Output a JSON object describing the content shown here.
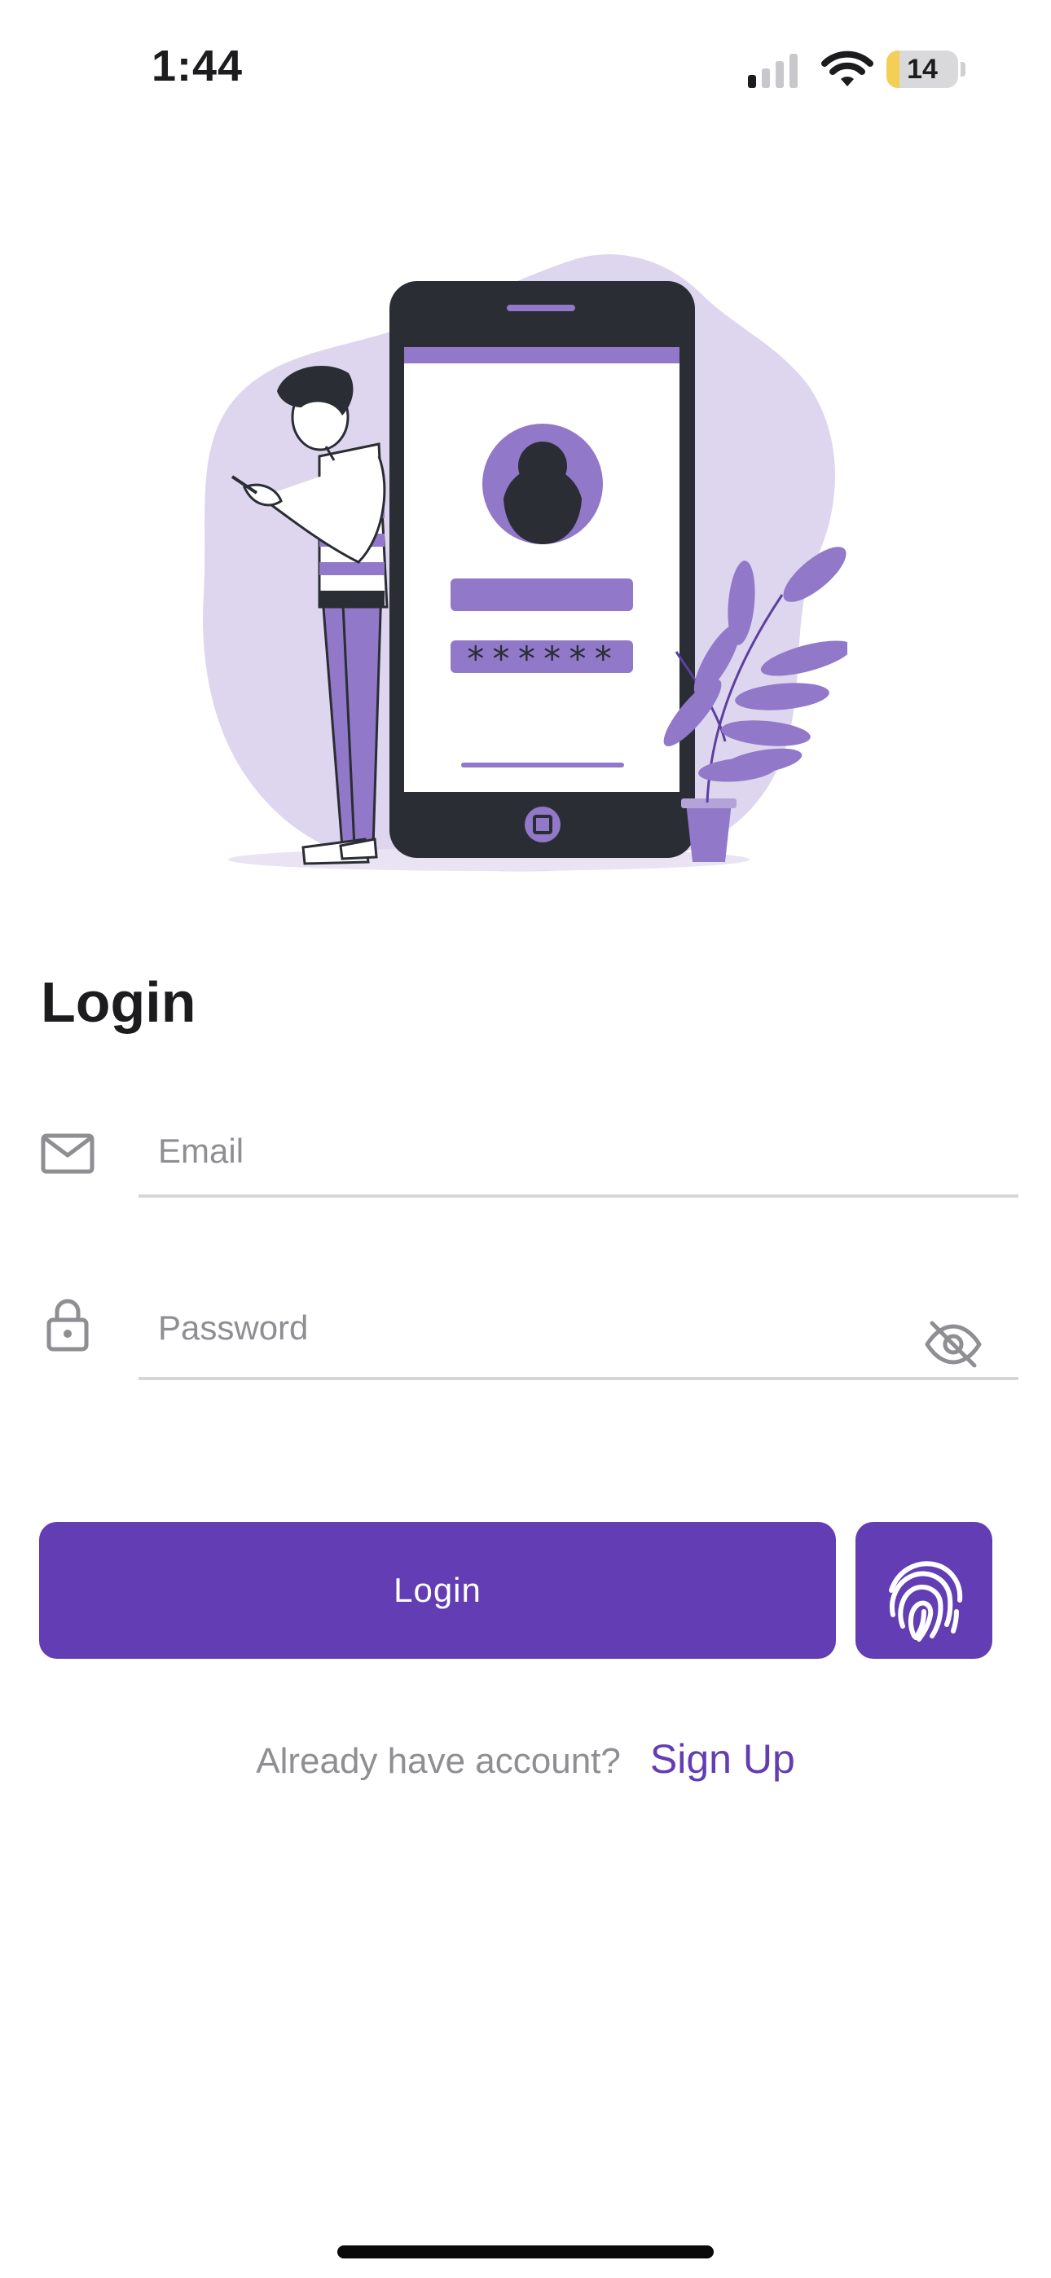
{
  "status_bar": {
    "time": "1:44",
    "battery_level": "14",
    "battery_fraction": 0.14,
    "icons": [
      "cellular-signal-icon",
      "wifi-icon",
      "battery-icon"
    ]
  },
  "illustration": {
    "phone_password_mask": "******"
  },
  "login": {
    "title": "Login",
    "email_placeholder": "Email",
    "password_placeholder": "Password",
    "button_label": "Login"
  },
  "signup": {
    "prompt": "Already have account?",
    "link_label": "Sign Up"
  },
  "colors": {
    "accent": "#623db3",
    "illustration_purple": "#9178c9",
    "illustration_light": "#ddd6ee",
    "dark": "#2a2d33",
    "placeholder": "#8e8e93",
    "divider": "#d6d6d6",
    "battery_low": "#f5cf55"
  }
}
